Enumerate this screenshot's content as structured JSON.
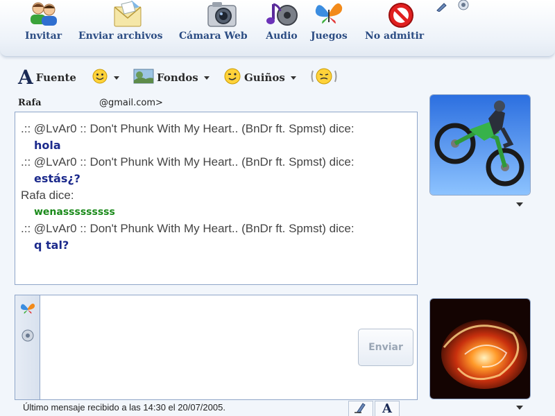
{
  "toolbar": {
    "invite_label": "Invitar",
    "send_files_label": "Enviar archivos",
    "webcam_label": "Cámara Web",
    "audio_label": "Audio",
    "games_label": "Juegos",
    "block_label": "No admitir"
  },
  "format_bar": {
    "font_label": "Fuente",
    "backgrounds_label": "Fondos",
    "winks_label": "Guiños"
  },
  "contact": {
    "name": "Rafa",
    "email": "@gmail.com>"
  },
  "messages": [
    {
      "sender": ".:: @LvAr0 :: Don't Phunk With My Heart.. (BnDr ft. Spmst) dice:",
      "text": "hola",
      "style": "remote"
    },
    {
      "sender": ".:: @LvAr0 :: Don't Phunk With My Heart.. (BnDr ft. Spmst) dice:",
      "text": "estás¿?",
      "style": "remote"
    },
    {
      "sender": "Rafa dice:",
      "text": "wenasssssssss",
      "style": "self"
    },
    {
      "sender": ".:: @LvAr0 :: Don't Phunk With My Heart.. (BnDr ft. Spmst) dice:",
      "text": "q tal?",
      "style": "remote"
    }
  ],
  "input": {
    "value": "",
    "send_label": "Enviar"
  },
  "status": {
    "last_message": "Último mensaje recibido a las 14:30 el 20/07/2005."
  },
  "icons": {
    "invite": "buddies-icon",
    "send_files": "envelope-icon",
    "webcam": "webcam-icon",
    "audio": "music-notes-icon",
    "games": "butterfly-icon",
    "block": "no-entry-icon",
    "font": "font-a-icon",
    "emoticon": "smiley-icon",
    "backgrounds": "landscape-icon",
    "winks": "wink-icon",
    "nudge": "nudge-icon"
  },
  "colors": {
    "toolbar_label": "#2b4c83",
    "remote_message": "#1c2a8c",
    "self_message": "#1a8a1a",
    "pane_border": "#8ea5c8"
  }
}
